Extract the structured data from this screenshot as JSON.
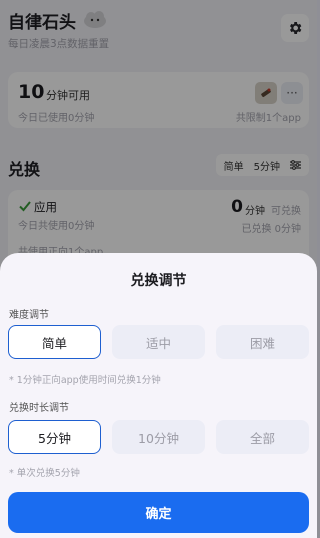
{
  "header": {
    "title": "自律石头",
    "subtitle": "每日凌晨3点数据重置"
  },
  "summary_card": {
    "value": "10",
    "unit": "分钟可用",
    "used_today": "今日已使用0分钟",
    "limited_apps": "共限制1个app"
  },
  "exchange": {
    "section_title": "兑换",
    "mode": {
      "difficulty": "简单",
      "duration": "5分钟"
    },
    "app_card": {
      "title": "应用",
      "used_today": "今日共使用0分钟",
      "positive_apps": "共使用正向1个app",
      "value": "0",
      "unit": "分钟",
      "tag": "可兑换",
      "exchanged": "已兑换 0分钟"
    }
  },
  "sheet": {
    "title": "兑换调节",
    "difficulty": {
      "label": "难度调节",
      "options": [
        "简单",
        "适中",
        "困难"
      ],
      "selected": "简单",
      "hint": "* 1分钟正向app使用时间兑换1分钟"
    },
    "duration": {
      "label": "兑换时长调节",
      "options": [
        "5分钟",
        "10分钟",
        "全部"
      ],
      "selected": "5分钟",
      "hint": "* 单次兑换5分钟"
    },
    "confirm_label": "确定"
  },
  "colors": {
    "accent": "#1a6cf0",
    "selected_border": "#1e5fd0",
    "background": "#f2f2f7"
  },
  "icons": [
    "cloud-mascot-icon",
    "gear-icon",
    "app-icon",
    "more-icon",
    "filter-icon",
    "checkmark-icon"
  ]
}
